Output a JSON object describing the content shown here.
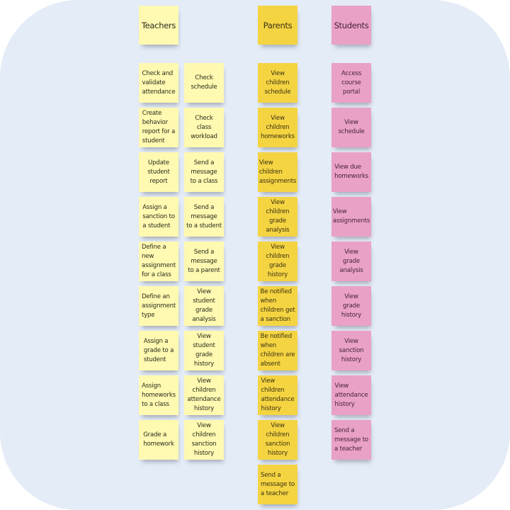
{
  "board": {
    "columns": [
      {
        "id": "teachers",
        "title": "Teachers",
        "color": "#fff9b1",
        "notes": [
          "Check and\nvalidate\nattendance",
          "Check\nschedule",
          "Create\nbehavior\nreport for a\nstudent",
          "Check\nclass\nworkload",
          "Update\nstudent\nreport",
          "Send a\nmessage\nto a class",
          "Assign a\nsanction to\na student",
          "Send a\nmessage\nto a student",
          "Define a\nnew\nassignment\nfor a class",
          "Send a\nmessage\nto a parent",
          "Define an\nassignment\ntype",
          "View\nstudent\ngrade\nanalysis",
          "Assign a\ngrade to a\nstudent",
          "View\nstudent\ngrade\nhistory",
          "Assign\nhomeworks\nto a class",
          "View\nchildren\nattendance\nhistory",
          "Grade a\nhomework",
          "View\nchildren\nsanction\nhistory"
        ]
      },
      {
        "id": "parents",
        "title": "Parents",
        "color": "#f5d442",
        "notes": [
          "View\nchildren\nschedule",
          "View\nchildren\nhomeworks",
          "View\nchildren\nassignments",
          "View\nchildren\ngrade\nanalysis",
          "View\nchildren\ngrade\nhistory",
          "Be notified\nwhen\nchildren get\na sanction",
          "Be notified\nwhen\nchildren are\nabsent",
          "View\nchildren\nattendance\nhistory",
          "View\nchildren\nsanction\nhistory",
          "Send a\nmessage to\na teacher"
        ]
      },
      {
        "id": "students",
        "title": "Students",
        "color": "#eaa1c6",
        "notes": [
          "Access\ncourse\nportal",
          "View\nschedule",
          "View due\nhomeworks",
          "View\nassignments",
          "View\ngrade\nanalysis",
          "View\ngrade\nhistory",
          "View\nsanction\nhistory",
          "View\nattendance\nhistory",
          "Send a\nmessage to\na teacher"
        ]
      }
    ]
  }
}
